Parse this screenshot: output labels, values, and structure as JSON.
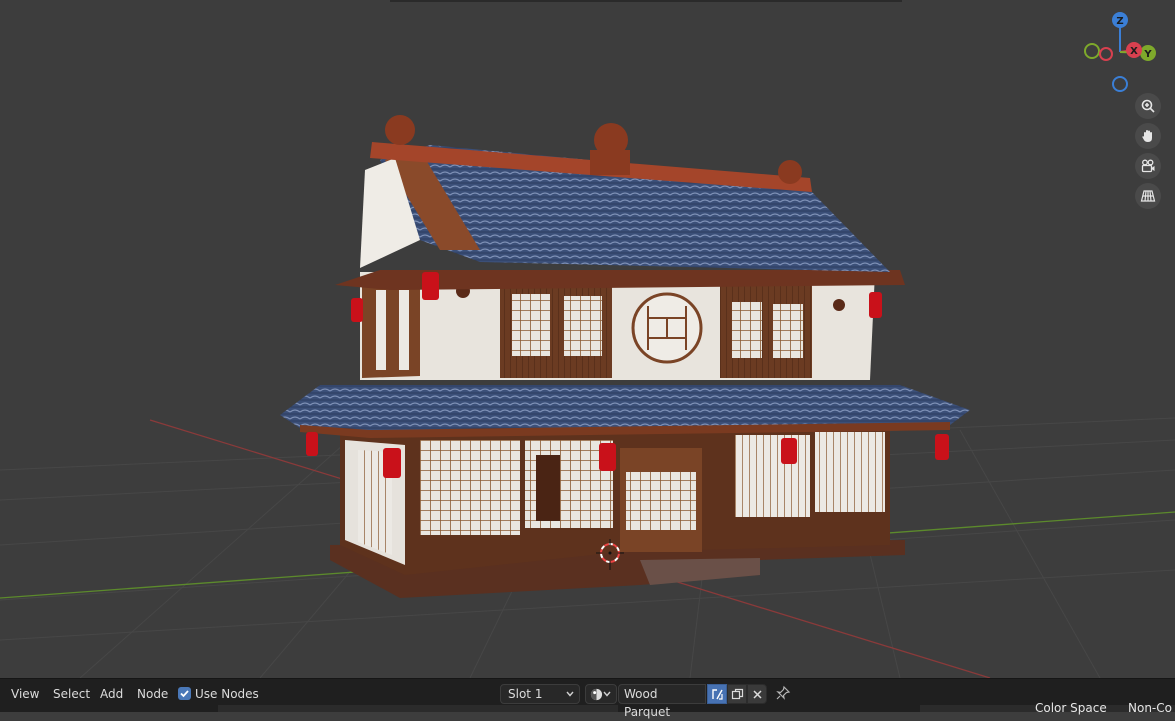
{
  "viewport": {
    "gizmo": {
      "x_label": "X",
      "y_label": "Y",
      "z_label": "Z",
      "colors": {
        "x": "#d8404f",
        "y": "#7ea92b",
        "z": "#3b7fd6"
      }
    },
    "nav_buttons": [
      "zoom-icon",
      "hand-pan-icon",
      "camera-icon",
      "grid-perspective-icon"
    ]
  },
  "footer": {
    "menu": {
      "view": "View",
      "select": "Select",
      "add": "Add",
      "node": "Node"
    },
    "use_nodes": {
      "label": "Use Nodes",
      "checked": true
    },
    "slot": {
      "value": "Slot 1"
    },
    "material": {
      "name": "Wood Parquet"
    },
    "overlap": {
      "color_space_label": "Color Space",
      "color_space_value": "Non-Co"
    }
  }
}
